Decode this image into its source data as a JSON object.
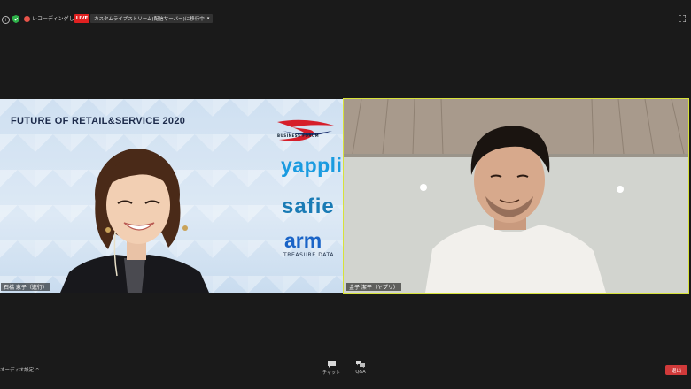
{
  "topbar": {
    "info_glyph": "i",
    "recording_text": "レコーディングしています",
    "live_badge": "LIVE",
    "stream_status": "カスタムライブストリーム(配信サーバー)に移行中"
  },
  "slide": {
    "title": "FUTURE OF RETAIL&SERVICE 2020",
    "forum_logo_text": "BUSINESS FORUM",
    "logo_yappli": "yappli",
    "logo_safie": "safie",
    "logo_arm": "arm",
    "logo_arm_sub": "TREASURE DATA"
  },
  "participants": [
    {
      "name": "石橋 恵子（進行）"
    },
    {
      "name": "金子 潔平（ヤプリ）"
    }
  ],
  "toolbar": {
    "audio_settings": "オーディオ設定",
    "caret": "^",
    "chat_label": "チャット",
    "qa_label": "Q&A",
    "leave_label": "退出"
  },
  "colors": {
    "active_speaker_border": "#d7e23a",
    "live_red": "#e02020",
    "leave_red": "#d13a3a",
    "yappli_blue": "#1a9be0"
  }
}
